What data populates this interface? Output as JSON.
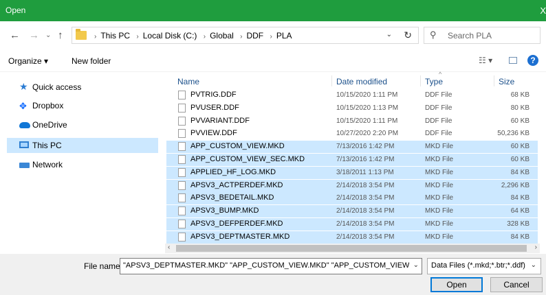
{
  "window": {
    "title": "Open",
    "close_glyph": "X"
  },
  "address": {
    "crumbs": [
      "This PC",
      "Local Disk (C:)",
      "Global",
      "DDF",
      "PLA"
    ],
    "search_placeholder": "Search PLA"
  },
  "toolbar": {
    "organize": "Organize ▾",
    "new_folder": "New folder",
    "help": "?"
  },
  "sidebar": {
    "items": [
      {
        "label": "Quick access",
        "icon": "star-icon"
      },
      {
        "label": "Dropbox",
        "icon": "dropbox-icon"
      },
      {
        "label": "OneDrive",
        "icon": "cloud-icon"
      },
      {
        "label": "This PC",
        "icon": "computer-icon",
        "selected": true
      },
      {
        "label": "Network",
        "icon": "network-icon"
      }
    ]
  },
  "columns": {
    "name": "Name",
    "date": "Date modified",
    "type": "Type",
    "size": "Size"
  },
  "files": [
    {
      "name": "PVTRIG.DDF",
      "date": "10/15/2020 1:11 PM",
      "type": "DDF File",
      "size": "68 KB",
      "selected": false
    },
    {
      "name": "PVUSER.DDF",
      "date": "10/15/2020 1:13 PM",
      "type": "DDF File",
      "size": "80 KB",
      "selected": false
    },
    {
      "name": "PVVARIANT.DDF",
      "date": "10/15/2020 1:11 PM",
      "type": "DDF File",
      "size": "60 KB",
      "selected": false
    },
    {
      "name": "PVVIEW.DDF",
      "date": "10/27/2020 2:20 PM",
      "type": "DDF File",
      "size": "50,236 KB",
      "selected": false
    },
    {
      "name": "APP_CUSTOM_VIEW.MKD",
      "date": "7/13/2016 1:42 PM",
      "type": "MKD File",
      "size": "60 KB",
      "selected": true
    },
    {
      "name": "APP_CUSTOM_VIEW_SEC.MKD",
      "date": "7/13/2016 1:42 PM",
      "type": "MKD File",
      "size": "60 KB",
      "selected": true
    },
    {
      "name": "APPLIED_HF_LOG.MKD",
      "date": "3/18/2011 1:13 PM",
      "type": "MKD File",
      "size": "84 KB",
      "selected": true
    },
    {
      "name": "APSV3_ACTPERDEF.MKD",
      "date": "2/14/2018 3:54 PM",
      "type": "MKD File",
      "size": "2,296 KB",
      "selected": true
    },
    {
      "name": "APSV3_BEDETAIL.MKD",
      "date": "2/14/2018 3:54 PM",
      "type": "MKD File",
      "size": "84 KB",
      "selected": true
    },
    {
      "name": "APSV3_BUMP.MKD",
      "date": "2/14/2018 3:54 PM",
      "type": "MKD File",
      "size": "64 KB",
      "selected": true
    },
    {
      "name": "APSV3_DEFPERDEF.MKD",
      "date": "2/14/2018 3:54 PM",
      "type": "MKD File",
      "size": "328 KB",
      "selected": true
    },
    {
      "name": "APSV3_DEPTMASTER.MKD",
      "date": "2/14/2018 3:54 PM",
      "type": "MKD File",
      "size": "84 KB",
      "selected": true
    }
  ],
  "footer": {
    "file_name_label": "File name:",
    "file_name_value": "\"APSV3_DEPTMASTER.MKD\" \"APP_CUSTOM_VIEW.MKD\" \"APP_CUSTOM_VIEW_SEC.MKD\"",
    "file_type": "Data Files (*.mkd;*.btr;*.ddf)",
    "open_label": "Open",
    "cancel_label": "Cancel"
  },
  "colors": {
    "titlebar": "#1f9d3e",
    "selection": "#cce8ff",
    "accent": "#0078d7"
  }
}
